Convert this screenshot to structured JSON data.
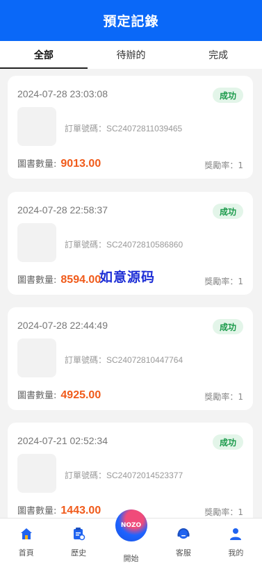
{
  "header": {
    "title": "預定記錄"
  },
  "tabs": [
    {
      "label": "全部",
      "active": true
    },
    {
      "label": "待辦的",
      "active": false
    },
    {
      "label": "完成",
      "active": false
    }
  ],
  "orders": [
    {
      "time": "2024-07-28 23:03:08",
      "status": "成功",
      "order_label": "訂單號碼：",
      "order_no": "SC24072811039465",
      "books_label": "圖書數量:",
      "books_value": "9013.00",
      "rate_label": "獎勵率：1"
    },
    {
      "time": "2024-07-28 22:58:37",
      "status": "成功",
      "order_label": "訂單號碼：",
      "order_no": "SC24072810586860",
      "books_label": "圖書數量:",
      "books_value": "8594.00",
      "rate_label": "獎勵率：1"
    },
    {
      "time": "2024-07-28 22:44:49",
      "status": "成功",
      "order_label": "訂單號碼：",
      "order_no": "SC24072810447764",
      "books_label": "圖書數量:",
      "books_value": "4925.00",
      "rate_label": "獎勵率：1"
    },
    {
      "time": "2024-07-21 02:52:34",
      "status": "成功",
      "order_label": "訂單號碼：",
      "order_no": "SC24072014523377",
      "books_label": "圖書數量:",
      "books_value": "1443.00",
      "rate_label": "獎勵率：1"
    }
  ],
  "watermark": "如意源码",
  "nav": [
    {
      "label": "首頁",
      "icon": "home-icon"
    },
    {
      "label": "歷史",
      "icon": "history-clipboard-icon"
    },
    {
      "label": "開始",
      "icon": "start-logo-icon",
      "badge_text": "NOZO"
    },
    {
      "label": "客服",
      "icon": "headset-icon"
    },
    {
      "label": "我的",
      "icon": "user-icon"
    }
  ],
  "colors": {
    "primary": "#0a68f8",
    "amount": "#f05a1a",
    "success_bg": "#e3f5e9",
    "success_text": "#1a9a4a"
  }
}
